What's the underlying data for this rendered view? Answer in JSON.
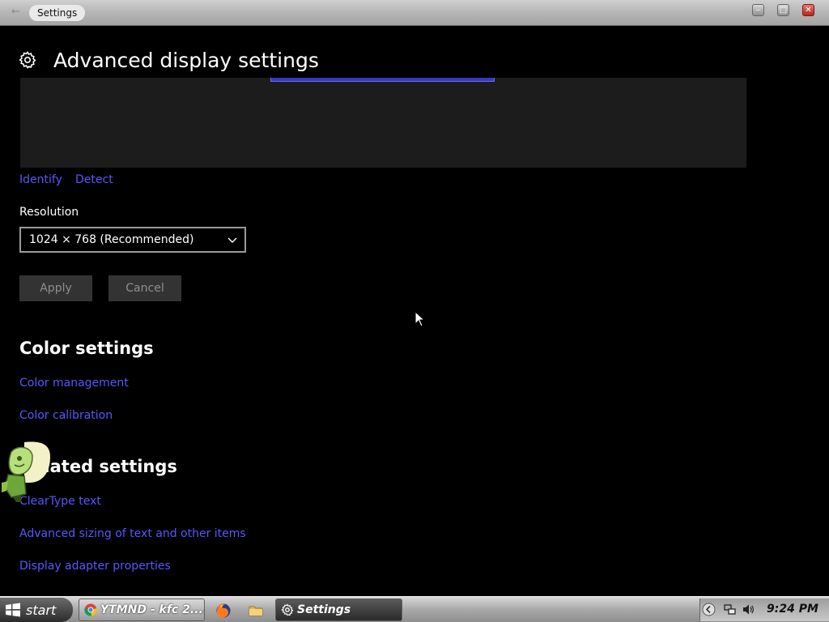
{
  "window": {
    "title": "Settings",
    "back_glyph": "←",
    "minimize_glyph": "–",
    "maximize_glyph": "□",
    "close_glyph": "✕"
  },
  "header": {
    "title": "Advanced display settings",
    "icon": "gear-icon"
  },
  "display_links": {
    "identify": "Identify",
    "detect": "Detect"
  },
  "resolution": {
    "label": "Resolution",
    "value": "1024 × 768 (Recommended)"
  },
  "buttons": {
    "apply": "Apply",
    "cancel": "Cancel"
  },
  "color_settings": {
    "title": "Color settings",
    "links": [
      "Color management",
      "Color calibration"
    ]
  },
  "related_settings": {
    "title": "Related settings",
    "links": [
      "ClearType text",
      "Advanced sizing of text and other items",
      "Display adapter properties"
    ]
  },
  "taskbar": {
    "start_label": "start",
    "tasks": [
      {
        "label": "YTMND - kfc 2....",
        "icon": "chrome-icon"
      },
      {
        "label": "Settings",
        "icon": "gear-icon"
      }
    ],
    "quick_launch": [
      "firefox-icon",
      "folder-icon"
    ],
    "clock": "9:24 PM"
  },
  "colors": {
    "link": "#5b55ff",
    "background": "#000000",
    "preview": "#1c1c1c",
    "accent": "#3a36c8"
  }
}
